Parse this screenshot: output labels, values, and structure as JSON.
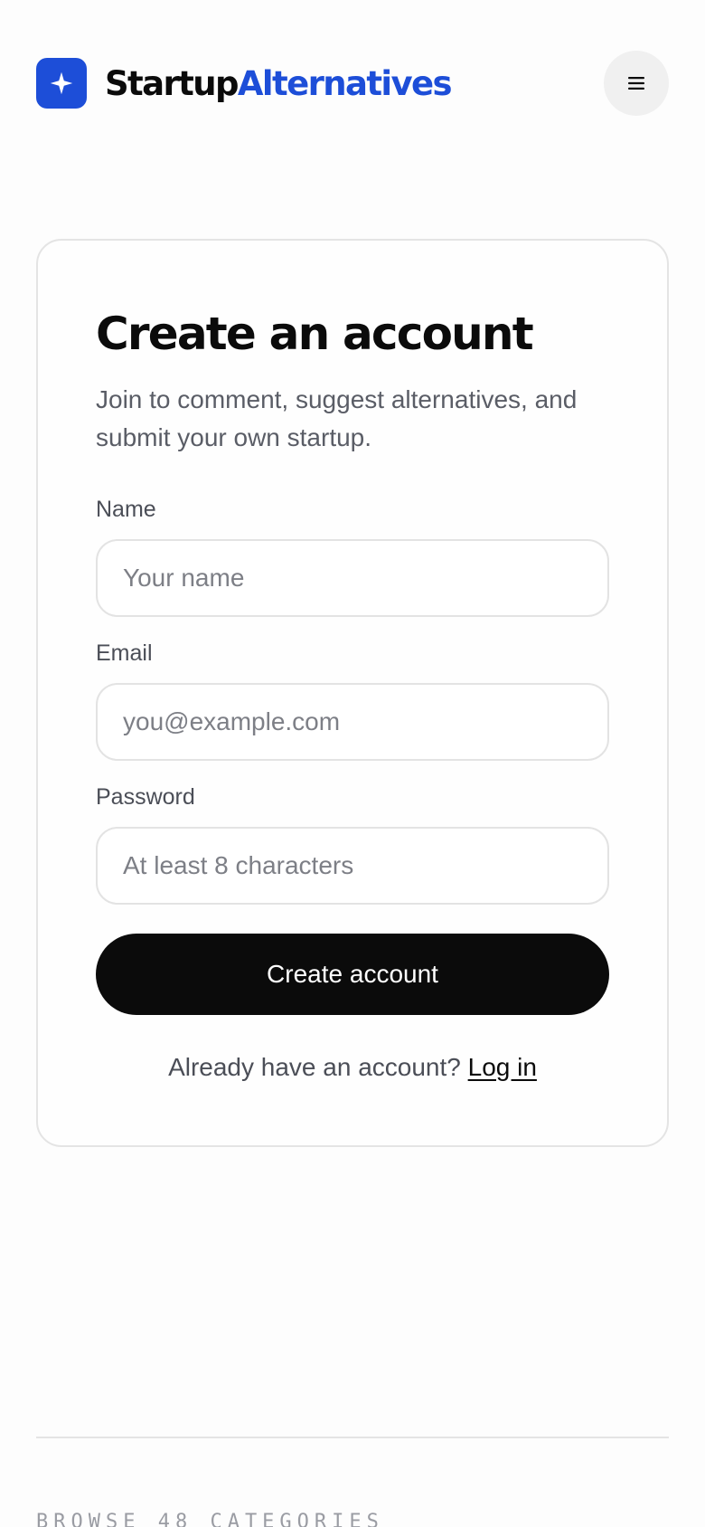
{
  "header": {
    "brand_part1": "Startup",
    "brand_part2": "Alternatives",
    "logo_icon": "sparkle-icon",
    "menu_icon": "hamburger-menu-icon"
  },
  "form": {
    "title": "Create an account",
    "subtitle": "Join to comment, suggest alternatives, and submit your own startup.",
    "name": {
      "label": "Name",
      "placeholder": "Your name",
      "value": ""
    },
    "email": {
      "label": "Email",
      "placeholder": "you@example.com",
      "value": ""
    },
    "password": {
      "label": "Password",
      "placeholder": "At least 8 characters",
      "value": ""
    },
    "submit_label": "Create account",
    "login_prompt": "Already have an account?",
    "login_link": "Log in"
  },
  "footer": {
    "caption": "BROWSE 48 CATEGORIES"
  },
  "colors": {
    "brand_blue": "#1d4ed8",
    "button_black": "#0b0b0b",
    "muted_text": "#5a5d66"
  }
}
